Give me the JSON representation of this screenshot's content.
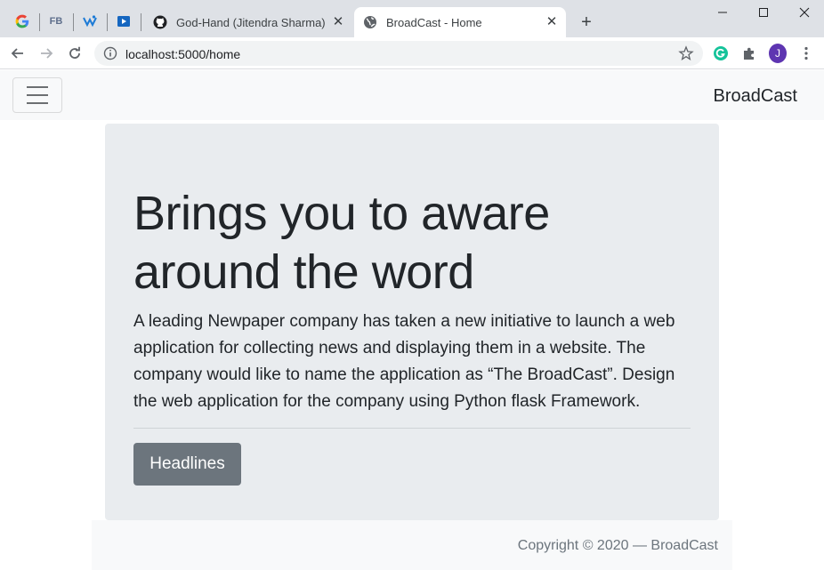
{
  "browser": {
    "pinned_tabs": [
      {
        "name": "google-pinned-tab",
        "icon": "google-icon"
      },
      {
        "name": "facebook-pinned-tab",
        "icon": "fb-icon",
        "label": "FB"
      },
      {
        "name": "teams-pinned-tab",
        "icon": "teams-icon"
      },
      {
        "name": "video-pinned-tab",
        "icon": "video-icon"
      }
    ],
    "tabs": [
      {
        "title": "God-Hand (Jitendra Sharma)",
        "icon": "github-icon",
        "active": false
      },
      {
        "title": "BroadCast - Home",
        "icon": "globe-icon",
        "active": true
      }
    ],
    "url": "localhost:5000/home",
    "profile_initial": "J",
    "colors": {
      "profile": "#5e35b1",
      "grammarly": "#15c39a"
    }
  },
  "navbar": {
    "brand": "BroadCast"
  },
  "jumbotron": {
    "heading": "Brings you to aware around the word",
    "lead": "A leading Newpaper company has taken a new initiative to launch a web application for collecting news and displaying them in a website. The company would like to name the application as “The BroadCast”. Design the web application for the company using Python flask Framework.",
    "button_label": "Headlines"
  },
  "footer": {
    "copyright": "Copyright © 2020 — BroadCast"
  }
}
